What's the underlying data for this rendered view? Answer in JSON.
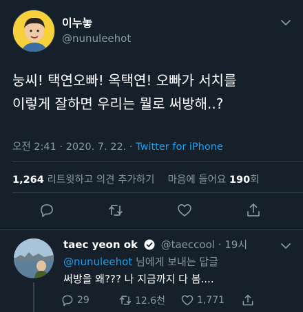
{
  "tweet": {
    "author_name": "이누놓",
    "author_handle": "@nunuleehot",
    "text_line1": "눙씨! 택연오빠! 옥택연! 오빠가 서치를",
    "text_line2": "이렇게 잘하면 우리는 뭘로 써방해..?",
    "time": "오전 2:41",
    "date": "2020. 7. 22.",
    "source": "Twitter for iPhone",
    "retweets_count": "1,264",
    "retweets_label": "리트윗하고 의견 추가하기",
    "likes_label": "마음에 들어요",
    "likes_count": "190",
    "likes_unit": "회"
  },
  "reply": {
    "author_name": "taec yeon ok",
    "author_handle": "@taeccool",
    "time": "19시",
    "mention": "@nunuleehot",
    "replying_suffix": "님에게 보내는 답글",
    "text": "써방을 왜??? 나 지금까지 다 봄....",
    "reply_count": "29",
    "retweet_count": "12.6천",
    "like_count": "1,771"
  },
  "colors": {
    "background": "#15202b",
    "text": "#ffffff",
    "muted": "#8899a6",
    "accent": "#1da1f2",
    "divider": "#38444d"
  },
  "icons": [
    "chevron-down-icon",
    "reply-icon",
    "retweet-icon",
    "heart-icon",
    "share-icon",
    "verified-badge-icon"
  ]
}
